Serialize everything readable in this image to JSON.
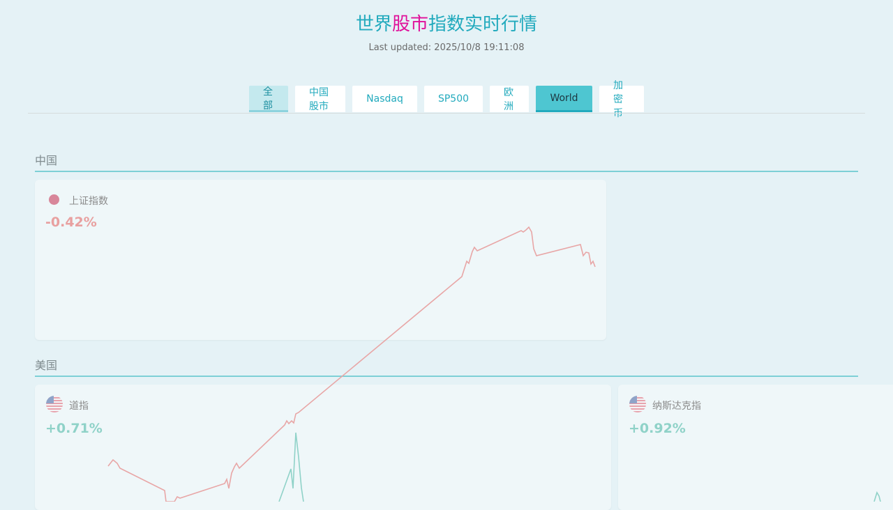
{
  "header": {
    "title_part1": "世界",
    "title_accent": "股市",
    "title_part2": "指数实时行情",
    "last_updated": "Last updated: 2025/10/8 19:11:08"
  },
  "tabs": [
    {
      "label": "全部",
      "state": "hover"
    },
    {
      "label": "中国股市",
      "state": "normal"
    },
    {
      "label": "Nasdaq",
      "state": "normal"
    },
    {
      "label": "SP500",
      "state": "normal"
    },
    {
      "label": "欧洲",
      "state": "normal"
    },
    {
      "label": "World",
      "state": "active"
    },
    {
      "label": "加密币",
      "state": "normal"
    }
  ],
  "sections": [
    {
      "title": "中国",
      "cards": [
        {
          "name": "上证指数",
          "change": "-0.42%",
          "icon": "china-dot-icon",
          "color": "#e8a0a0"
        }
      ]
    },
    {
      "title": "美国",
      "cards": [
        {
          "name": "道指",
          "change": "+0.71%",
          "icon": "us-flag-icon",
          "color": "#8fd2c8"
        },
        {
          "name": "纳斯达克指",
          "change": "+0.92%",
          "icon": "us-flag-icon",
          "color": "#8fd2c8"
        }
      ]
    }
  ],
  "colors": {
    "accent": "#22aabd",
    "title_accent": "#e0109a",
    "down": "#e8a0a0",
    "up": "#8fd2c8"
  }
}
